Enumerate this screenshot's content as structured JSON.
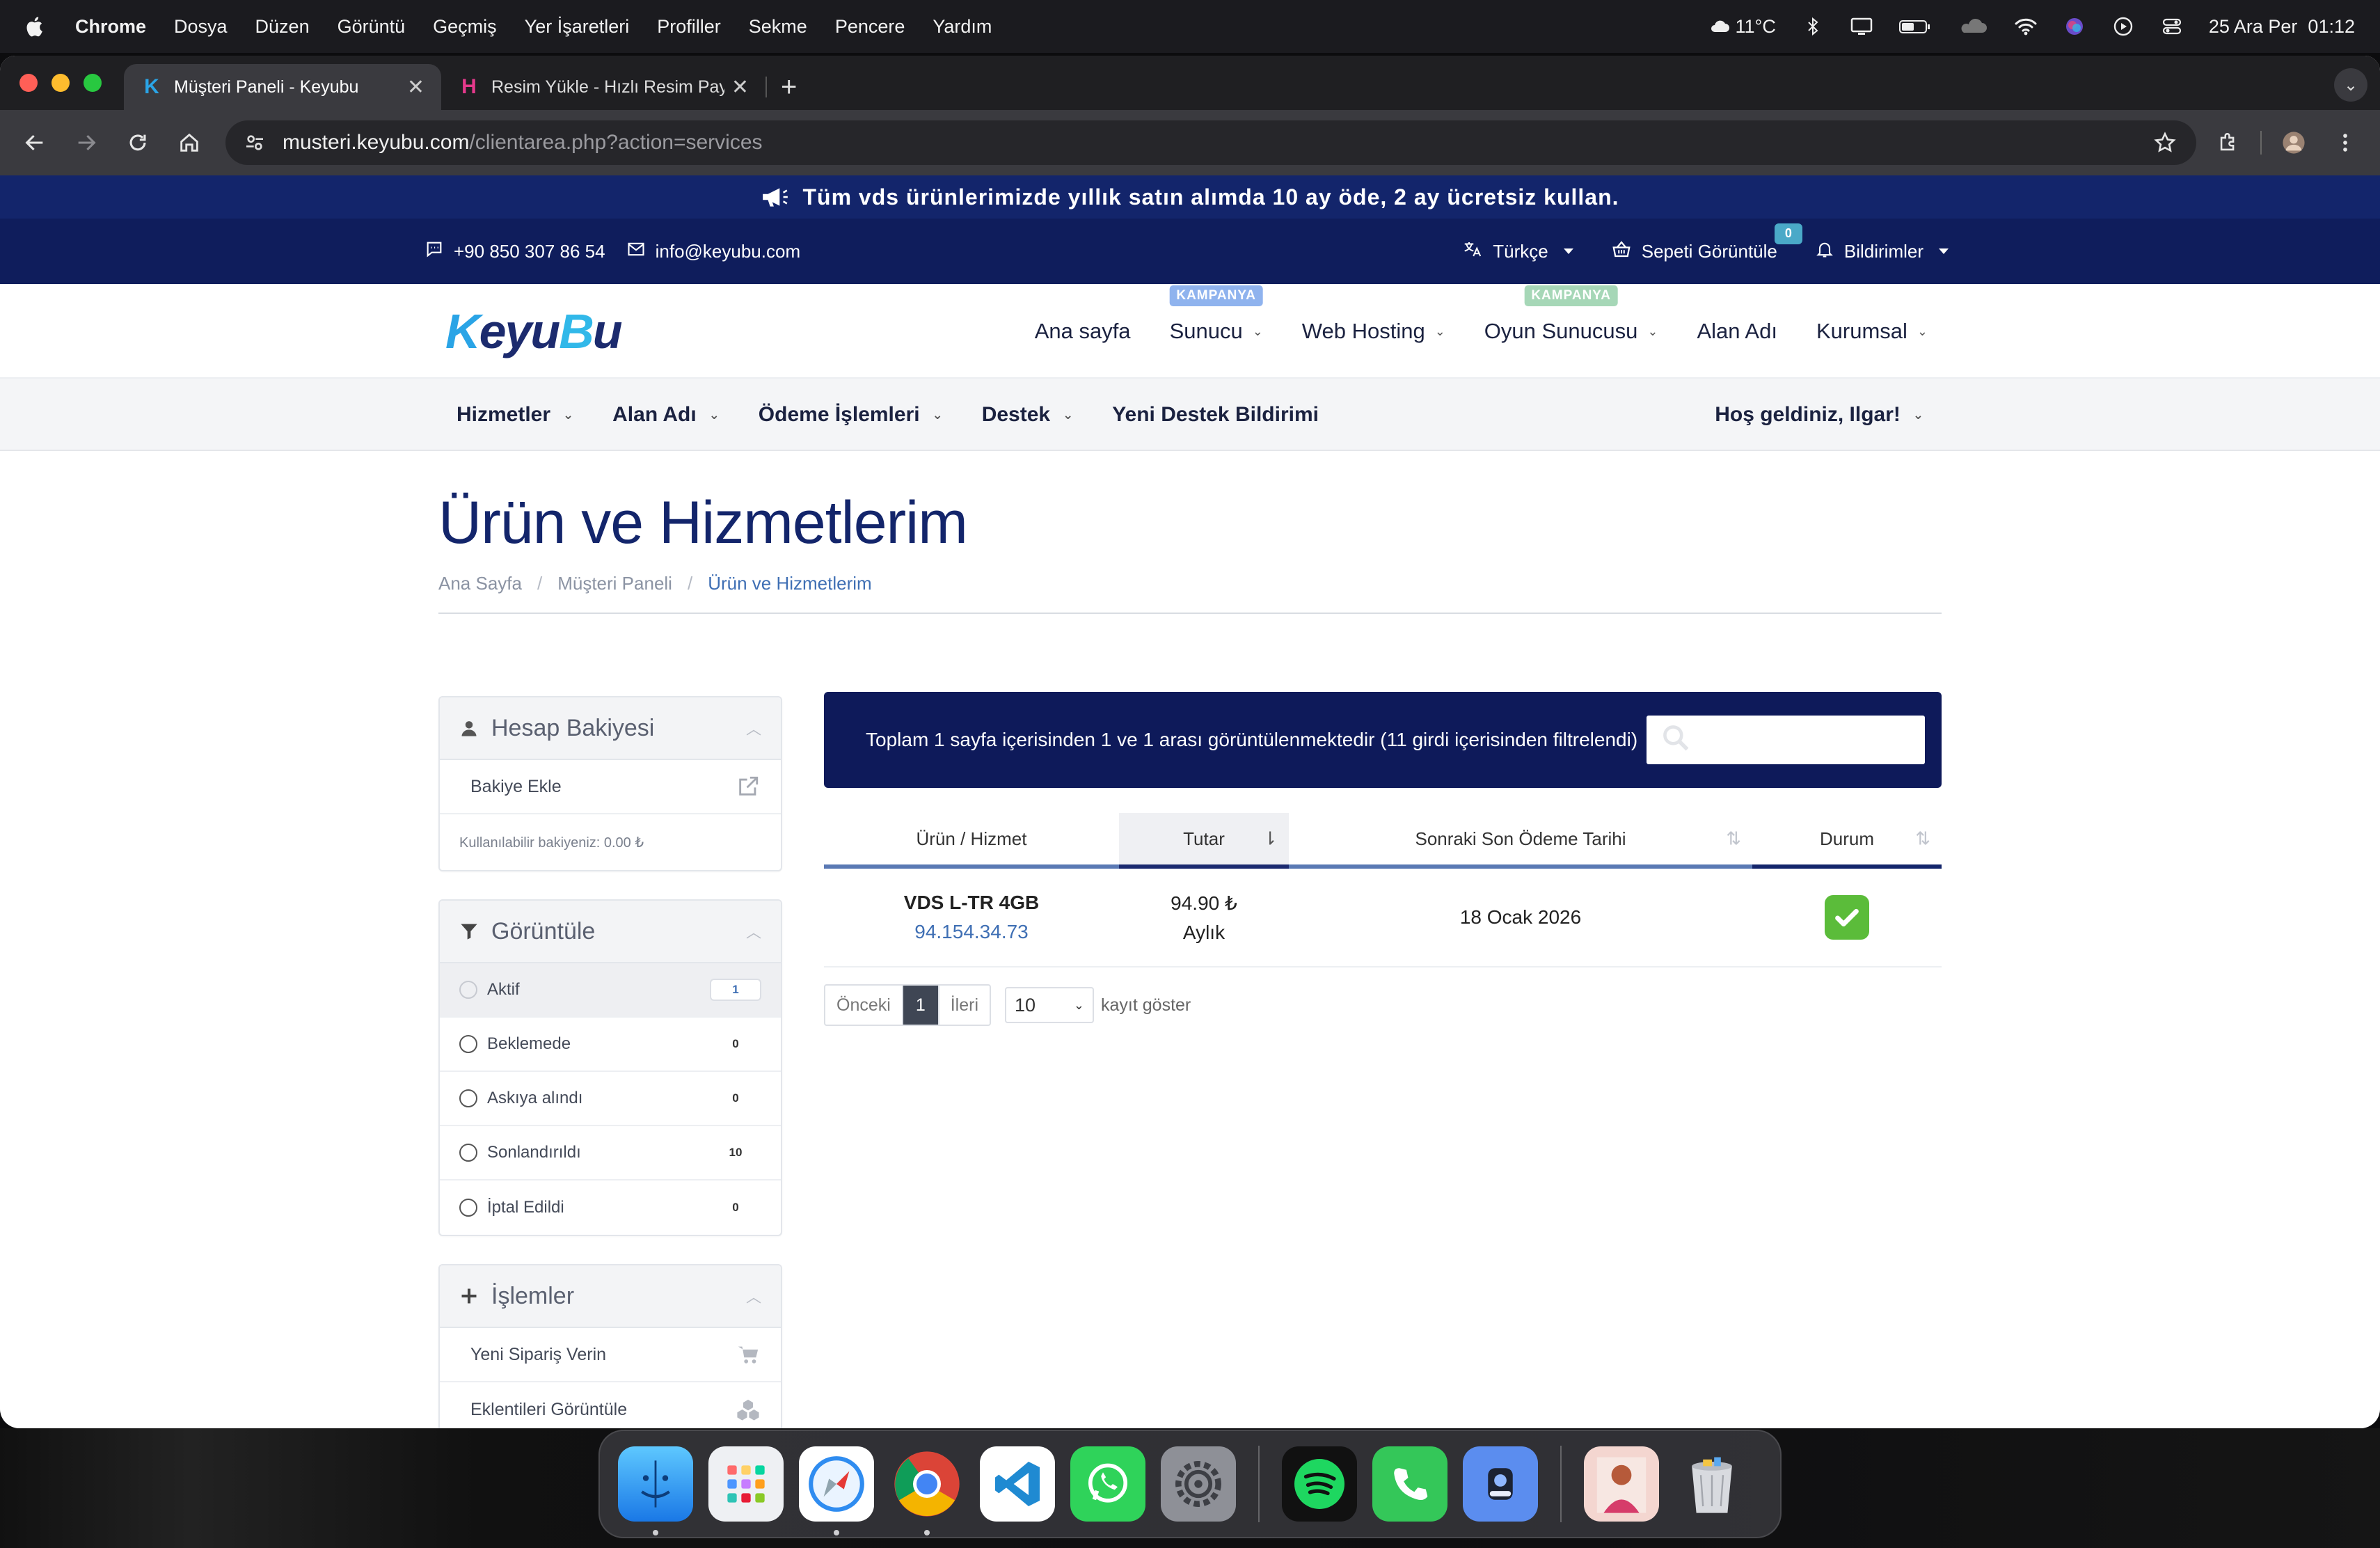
{
  "menubar": {
    "app": "Chrome",
    "items": [
      "Dosya",
      "Düzen",
      "Görüntü",
      "Geçmiş",
      "Yer İşaretleri",
      "Profiller",
      "Sekme",
      "Pencere",
      "Yardım"
    ],
    "weather": "11°C",
    "datetime": "25 Ara Per  01:12"
  },
  "browser": {
    "tabs": [
      {
        "title": "Müşteri Paneli - Keyubu",
        "favicon": "K"
      },
      {
        "title": "Resim Yükle - Hızlı Resim Pay",
        "favicon": "H"
      }
    ],
    "url_host": "musteri.keyubu.com",
    "url_path": "/clientarea.php?action=services"
  },
  "site": {
    "promo": "Tüm vds ürünlerimizde yıllık satın alımda 10 ay öde, 2 ay ücretsiz kullan.",
    "phone": "+90 850 307 86 54",
    "email": "info@keyubu.com",
    "language": "Türkçe",
    "cart": "Sepeti Görüntüle",
    "cart_count": "0",
    "notifications": "Bildirimler",
    "logo_parts": [
      "K",
      "eyu",
      "B",
      "u"
    ],
    "mainnav": [
      {
        "label": "Ana sayfa",
        "badge": "",
        "chevron": false
      },
      {
        "label": "Sunucu",
        "badge": "KAMPANYA",
        "chevron": true
      },
      {
        "label": "Web Hosting",
        "badge": "",
        "chevron": true
      },
      {
        "label": "Oyun Sunucusu",
        "badge": "KAMPANYA",
        "chevron": true
      },
      {
        "label": "Alan Adı",
        "badge": "",
        "chevron": false
      },
      {
        "label": "Kurumsal",
        "badge": "",
        "chevron": true
      }
    ],
    "subnav": [
      "Hizmetler",
      "Alan Adı",
      "Ödeme İşlemleri",
      "Destek",
      "Yeni Destek Bildirimi"
    ],
    "greeting": "Hoş geldiniz, Ilgar!",
    "page_title": "Ürün ve Hizmetlerim",
    "breadcrumb": [
      "Ana Sayfa",
      "Müşteri Paneli",
      "Ürün ve Hizmetlerim"
    ]
  },
  "sidebar": {
    "balance": {
      "title": "Hesap Bakiyesi",
      "add": "Bakiye Ekle",
      "note": "Kullanılabilir bakiyeniz: 0.00 ₺"
    },
    "filter": {
      "title": "Görüntüle",
      "items": [
        {
          "label": "Aktif",
          "count": "1"
        },
        {
          "label": "Beklemede",
          "count": "0"
        },
        {
          "label": "Askıya alındı",
          "count": "0"
        },
        {
          "label": "Sonlandırıldı",
          "count": "10"
        },
        {
          "label": "İptal Edildi",
          "count": "0"
        }
      ]
    },
    "actions": {
      "title": "İşlemler",
      "items": [
        "Yeni Sipariş Verin",
        "Eklentileri Görüntüle"
      ]
    }
  },
  "table": {
    "info": "Toplam 1 sayfa içerisinden 1 ve 1 arası görüntülenmektedir (11 girdi içerisinden filtrelendi)",
    "headers": [
      "Ürün / Hizmet",
      "Tutar",
      "Sonraki Son Ödeme Tarihi",
      "Durum"
    ],
    "rows": [
      {
        "product": "VDS L-TR 4GB",
        "ip": "94.154.34.73",
        "price": "94.90 ₺",
        "cycle": "Aylık",
        "due": "18 Ocak 2026",
        "status": "active"
      }
    ],
    "prev": "Önceki",
    "page": "1",
    "next": "İleri",
    "per_page": "10",
    "per_page_label": "kayıt göster"
  },
  "colors": {
    "promo_bg": "#13256b",
    "topbar_bg": "#0f1d5c",
    "accent": "#13256b",
    "link": "#3f6fb4",
    "status_ok": "#5bbc3a"
  }
}
